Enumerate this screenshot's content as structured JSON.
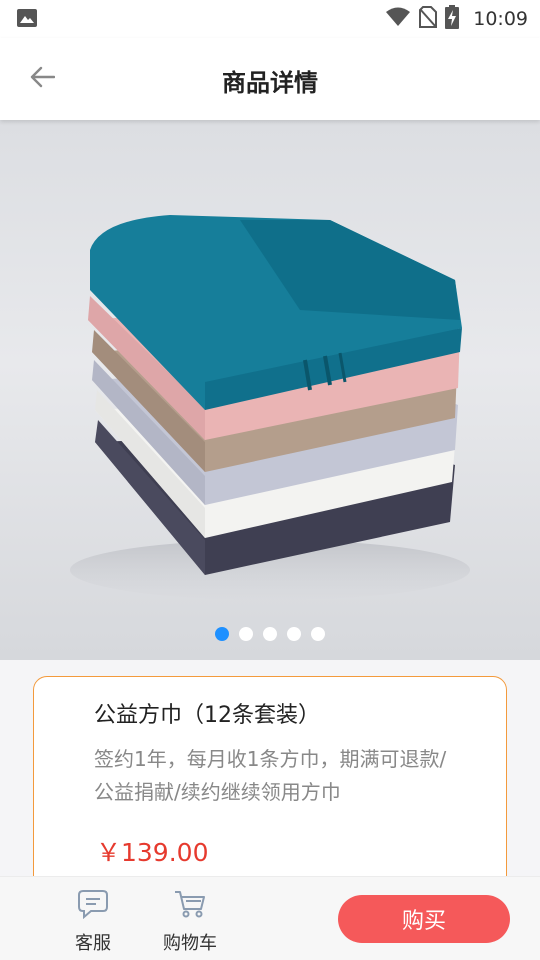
{
  "status_bar": {
    "time": "10:09",
    "icons": [
      "image-icon",
      "wifi-icon",
      "no-sim-icon",
      "battery-charging-icon"
    ]
  },
  "header": {
    "title": "商品详情",
    "back_icon": "arrow-left-icon"
  },
  "carousel": {
    "image_subject": "stacked towels",
    "slide_count": 5,
    "active_index": 0,
    "colors": {
      "active_dot": "#1e90ff",
      "inactive_dot": "#ffffff"
    }
  },
  "product": {
    "name": "公益方巾（12条套装）",
    "description": "签约1年，每月收1条方巾，期满可退款/公益捐献/续约继续领用方巾",
    "price": "￥139.00",
    "colors": {
      "price": "#e63a2e",
      "border": "#f39a3c"
    }
  },
  "bottom_bar": {
    "service_label": "客服",
    "service_icon": "chat-bubble-icon",
    "cart_label": "购物车",
    "cart_icon": "cart-icon",
    "buy_label": "购买",
    "colors": {
      "buy_button": "#f5595a"
    }
  }
}
